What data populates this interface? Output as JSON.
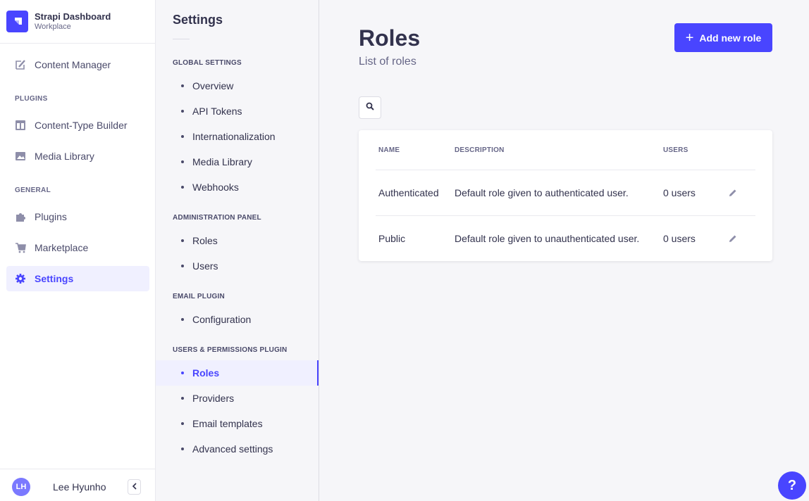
{
  "brand": {
    "title": "Strapi Dashboard",
    "subtitle": "Workplace"
  },
  "main_nav": {
    "content_manager": "Content Manager",
    "plugins_heading": "PLUGINS",
    "content_type_builder": "Content-Type Builder",
    "media_library": "Media Library",
    "general_heading": "GENERAL",
    "plugins": "Plugins",
    "marketplace": "Marketplace",
    "settings": "Settings"
  },
  "user": {
    "initials": "LH",
    "name": "Lee Hyunho"
  },
  "settings_nav": {
    "title": "Settings",
    "sections": [
      {
        "heading": "GLOBAL SETTINGS",
        "items": [
          "Overview",
          "API Tokens",
          "Internationalization",
          "Media Library",
          "Webhooks"
        ]
      },
      {
        "heading": "ADMINISTRATION PANEL",
        "items": [
          "Roles",
          "Users"
        ]
      },
      {
        "heading": "EMAIL PLUGIN",
        "items": [
          "Configuration"
        ]
      },
      {
        "heading": "USERS & PERMISSIONS PLUGIN",
        "items": [
          "Roles",
          "Providers",
          "Email templates",
          "Advanced settings"
        ]
      }
    ],
    "active_item": "Roles"
  },
  "page": {
    "title": "Roles",
    "subtitle": "List of roles",
    "add_button": "Add new role"
  },
  "table": {
    "headers": {
      "name": "NAME",
      "description": "DESCRIPTION",
      "users": "USERS"
    },
    "rows": [
      {
        "name": "Authenticated",
        "description": "Default role given to authenticated user.",
        "users": "0 users"
      },
      {
        "name": "Public",
        "description": "Default role given to unauthenticated user.",
        "users": "0 users"
      }
    ]
  },
  "help": {
    "label": "?"
  },
  "colors": {
    "primary": "#4945ff",
    "active_bg": "#f0f0ff",
    "text": "#32324d",
    "muted": "#666687"
  }
}
